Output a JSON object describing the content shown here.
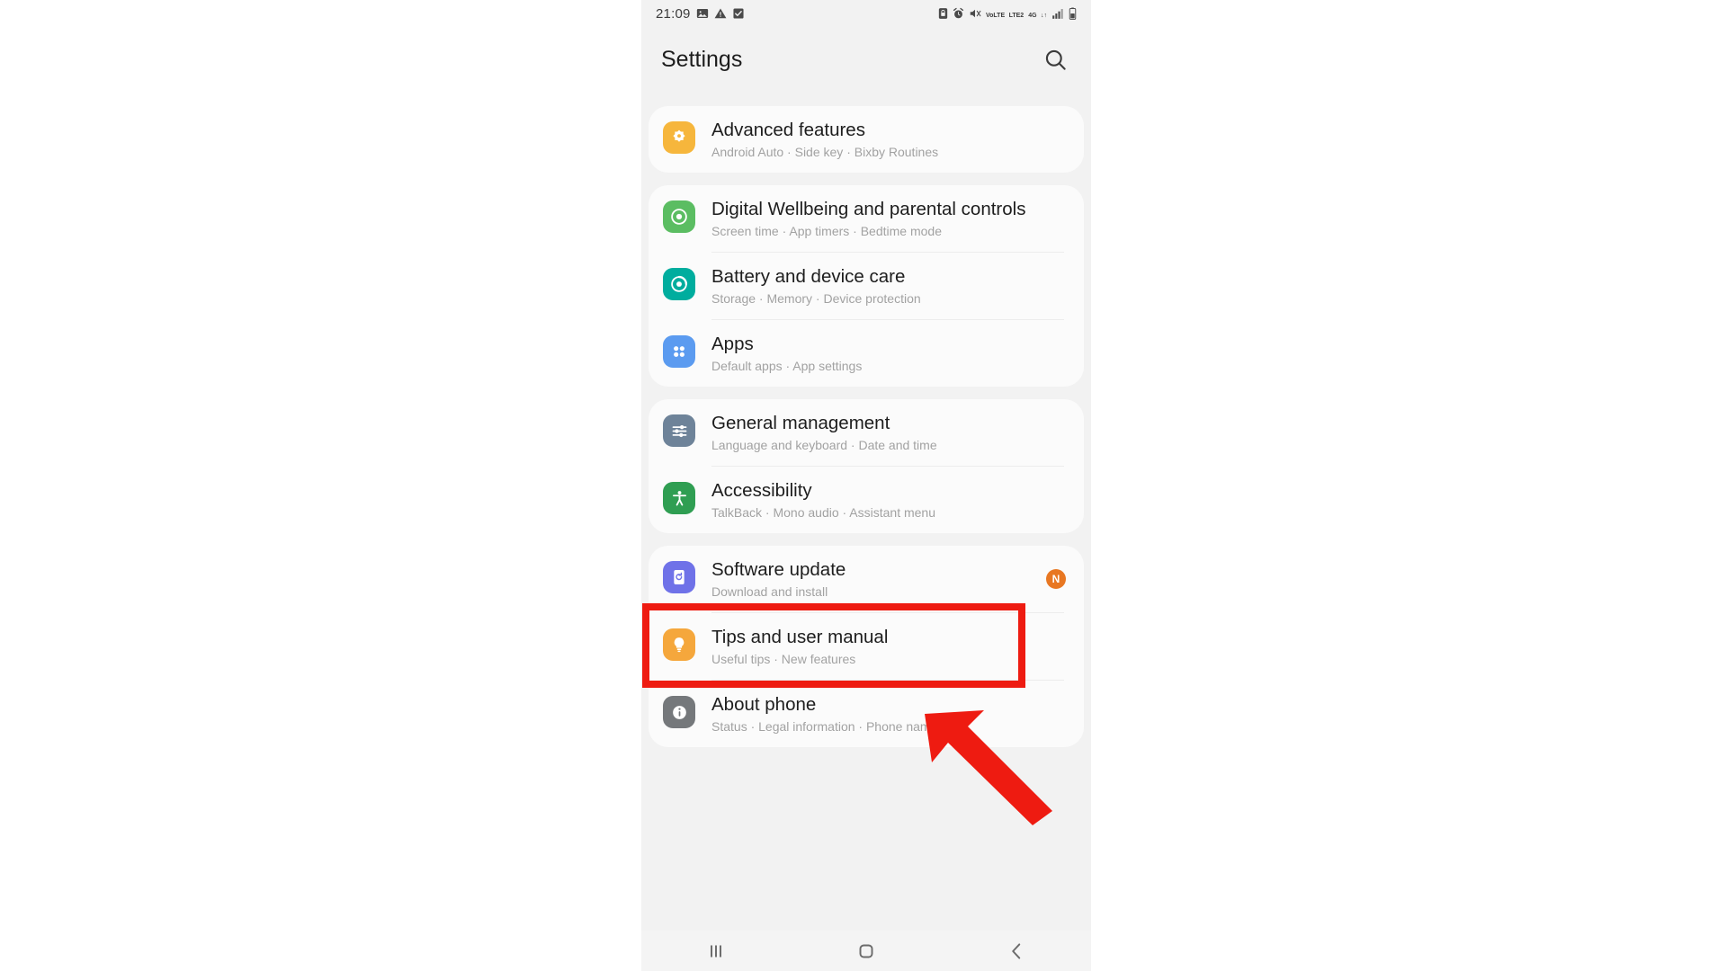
{
  "status_bar": {
    "time": "21:09",
    "left_icons": [
      "image-icon",
      "warning-triangle-icon",
      "checkbox-icon"
    ],
    "right_icons": [
      "lock-icon",
      "alarm-clock-icon",
      "mute-vibrate-icon",
      "volte-icon",
      "4g-icon",
      "signal-bars-icon",
      "battery-icon"
    ],
    "volte_top": "VoLTE",
    "volte_bottom": "LTE2",
    "net_top": "4G",
    "net_bottom": "↓↑"
  },
  "app_bar": {
    "title": "Settings",
    "search_icon": "search-icon"
  },
  "cards": [
    {
      "rows": [
        {
          "title": "Advanced features",
          "subtitle": "Android Auto  ·  Side key  ·  Bixby Routines",
          "icon": "gear-plus-icon",
          "icon_color": "#f6b63c",
          "badge": null,
          "highlighted": false
        }
      ]
    },
    {
      "rows": [
        {
          "title": "Digital Wellbeing and parental controls",
          "subtitle": "Screen time  ·  App timers  ·  Bedtime mode",
          "icon": "wellbeing-circle-icon",
          "icon_color": "#5bbd62",
          "badge": null,
          "highlighted": false
        },
        {
          "title": "Battery and device care",
          "subtitle": "Storage  ·  Memory  ·  Device protection",
          "icon": "device-care-icon",
          "icon_color": "#00ad9e",
          "badge": null,
          "highlighted": false
        },
        {
          "title": "Apps",
          "subtitle": "Default apps  ·  App settings",
          "icon": "apps-grid-icon",
          "icon_color": "#5b9bf0",
          "badge": null,
          "highlighted": false
        }
      ]
    },
    {
      "rows": [
        {
          "title": "General management",
          "subtitle": "Language and keyboard  ·  Date and time",
          "icon": "sliders-icon",
          "icon_color": "#6e8399",
          "badge": null,
          "highlighted": false
        },
        {
          "title": "Accessibility",
          "subtitle": "TalkBack  ·  Mono audio  ·  Assistant menu",
          "icon": "accessibility-person-icon",
          "icon_color": "#2f9e52",
          "badge": null,
          "highlighted": true
        }
      ]
    },
    {
      "rows": [
        {
          "title": "Software update",
          "subtitle": "Download and install",
          "icon": "software-update-icon",
          "icon_color": "#6f72e8",
          "badge": "N",
          "highlighted": false
        },
        {
          "title": "Tips and user manual",
          "subtitle": "Useful tips  ·  New features",
          "icon": "lightbulb-icon",
          "icon_color": "#f5a73c",
          "badge": null,
          "highlighted": false
        },
        {
          "title": "About phone",
          "subtitle": "Status  ·  Legal information  ·  Phone name",
          "icon": "info-icon",
          "icon_color": "#75787b",
          "badge": null,
          "highlighted": false
        }
      ]
    }
  ],
  "nav_bar": {
    "recents_icon": "recents-icon",
    "home_icon": "home-icon",
    "back_icon": "back-icon"
  },
  "annotations": {
    "highlight_color": "#ee1b11",
    "arrow_color": "#ee1b11",
    "highlight_target": "Accessibility",
    "arrow_target": "Accessibility"
  }
}
